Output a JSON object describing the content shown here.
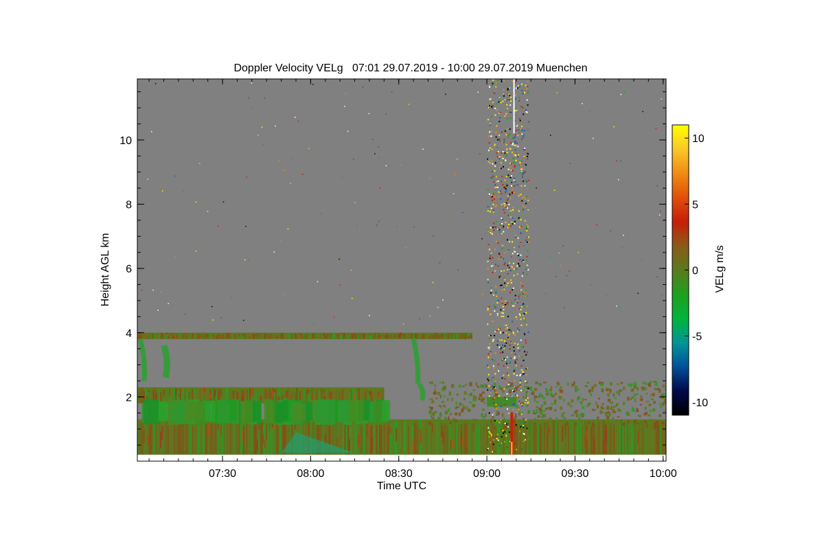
{
  "chart_data": {
    "type": "heatmap",
    "title": "Doppler Velocity VELg   07:01 29.07.2019 - 10:00 29.07.2019 Muenchen",
    "xlabel": "Time UTC",
    "ylabel": "Height AGL km",
    "x_range": [
      "07:01",
      "10:01"
    ],
    "x_ticks": [
      "07:30",
      "08:00",
      "08:30",
      "09:00",
      "09:30",
      "10:00"
    ],
    "y_range": [
      0,
      11.9
    ],
    "y_ticks": [
      2,
      4,
      6,
      8,
      10
    ],
    "colorbar": {
      "label": "VELg m/s",
      "range": [
        -11,
        11
      ],
      "ticks": [
        10,
        5,
        0,
        -5,
        -10
      ]
    },
    "colors": {
      "no_signal": "#808080",
      "scale": [
        "#000000",
        "#000a4a",
        "#00509a",
        "#009696",
        "#00b43c",
        "#1ea01e",
        "#5a7a1e",
        "#8a5a1a",
        "#c81e0a",
        "#e0500a",
        "#f08c14",
        "#fac828",
        "#ffff00"
      ]
    },
    "features": [
      {
        "name": "Upper cloud layer",
        "time": [
          "07:01",
          "08:55"
        ],
        "height": [
          3.8,
          4.0
        ]
      },
      {
        "name": "Lower cloud layer",
        "time": [
          "07:01",
          "08:25"
        ],
        "height": [
          1.8,
          2.3
        ]
      },
      {
        "name": "Boundary layer",
        "time": [
          "07:01",
          "10:01"
        ],
        "height": [
          0.2,
          1.3
        ]
      },
      {
        "name": "Precipitation streak",
        "time": [
          "09:08",
          "09:10"
        ],
        "height": [
          0.0,
          1.5
        ]
      }
    ]
  }
}
